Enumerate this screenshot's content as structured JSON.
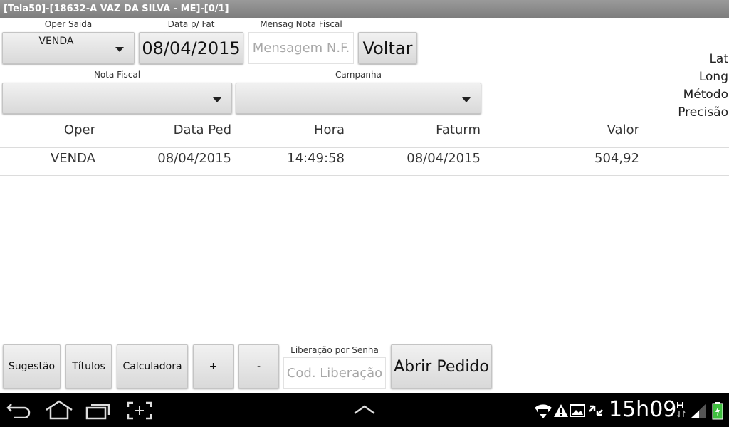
{
  "window": {
    "title": "[Tela50]-[18632-A VAZ DA SILVA - ME]-[0/1]"
  },
  "form": {
    "oper_saida_label": "Oper Saida",
    "oper_saida_value": "VENDA",
    "data_fat_label": "Data p/ Fat",
    "data_fat_value": "08/04/2015",
    "mensag_label": "Mensag Nota Fiscal",
    "mensag_placeholder": "Mensagem N.F.",
    "voltar_label": "Voltar",
    "nota_fiscal_label": "Nota Fiscal",
    "nota_fiscal_value": "",
    "campanha_label": "Campanha",
    "campanha_value": ""
  },
  "location": {
    "lat_label": "Lat",
    "long_label": "Long",
    "metodo_label": "Método",
    "precisao_label": "Precisão"
  },
  "table": {
    "headers": [
      "Oper",
      "Data Ped",
      "Hora",
      "Faturm",
      "Valor"
    ],
    "rows": [
      [
        "VENDA",
        "08/04/2015",
        "14:49:58",
        "08/04/2015",
        "504,92"
      ]
    ]
  },
  "bottom": {
    "sugestao_label": "Sugestão",
    "titulos_label": "Títulos",
    "calculadora_label": "Calculadora",
    "plus_label": "+",
    "minus_label": "-",
    "liberacao_label": "Liberação por Senha",
    "liberacao_placeholder": "Cod. Liberação",
    "abrir_label": "Abrir Pedido"
  },
  "statusbar": {
    "time": "15h09",
    "icons": [
      "back-icon",
      "home-icon",
      "recent-apps-icon",
      "screenshot-icon",
      "up-arrow-icon",
      "wifi-icon",
      "warning-icon",
      "image-icon",
      "sync-icon",
      "hspa-icon",
      "signal-icon",
      "battery-icon"
    ]
  }
}
